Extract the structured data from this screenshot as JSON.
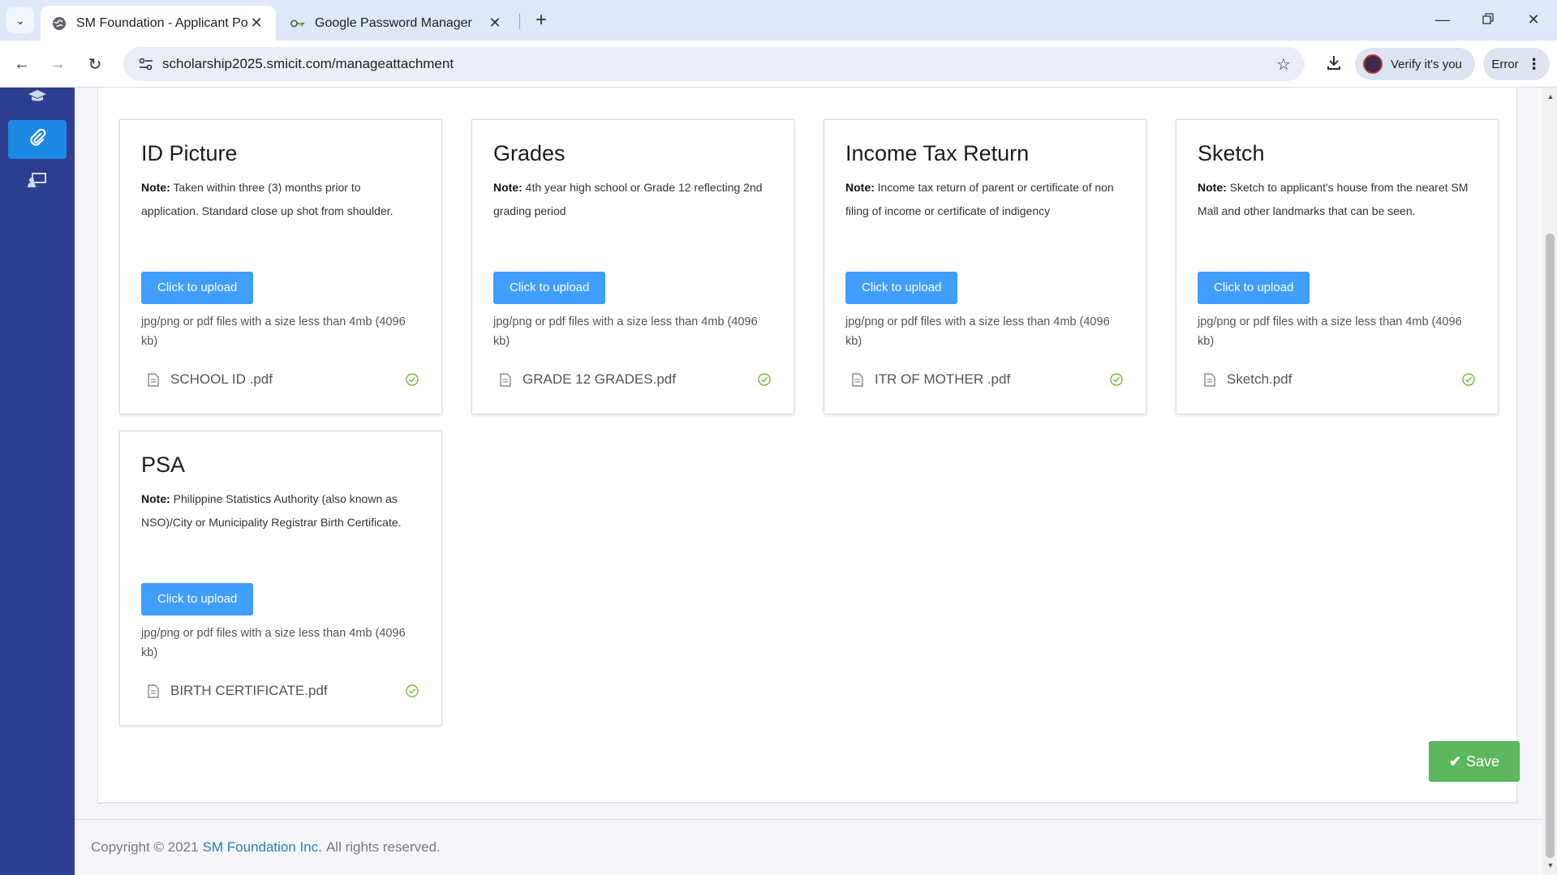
{
  "browser": {
    "tabs": [
      {
        "title": "SM Foundation - Applicant Port",
        "active": true
      },
      {
        "title": "Google Password Manager",
        "active": false
      }
    ],
    "url": "scholarship2025.smicit.com/manageattachment",
    "verify_label": "Verify it's you",
    "error_label": "Error"
  },
  "cards": [
    {
      "title": "ID Picture",
      "note_label": "Note:",
      "note_text": "Taken within three (3) months prior to application. Standard close up shot from shoulder.",
      "button_label": "Click to upload",
      "hint": "jpg/png or pdf files with a size less than 4mb (4096 kb)",
      "file_name": "SCHOOL ID .pdf"
    },
    {
      "title": "Grades",
      "note_label": "Note:",
      "note_text": "4th year high school or Grade 12 reflecting 2nd grading period",
      "button_label": "Click to upload",
      "hint": "jpg/png or pdf files with a size less than 4mb (4096 kb)",
      "file_name": "GRADE 12 GRADES.pdf"
    },
    {
      "title": "Income Tax Return",
      "note_label": "Note:",
      "note_text": "Income tax return of parent or certificate of non filing of income or certificate of indigency",
      "button_label": "Click to upload",
      "hint": "jpg/png or pdf files with a size less than 4mb (4096 kb)",
      "file_name": "ITR OF MOTHER .pdf"
    },
    {
      "title": "Sketch",
      "note_label": "Note:",
      "note_text": "Sketch to applicant's house from the nearet SM Mall and other landmarks that can be seen.",
      "button_label": "Click to upload",
      "hint": "jpg/png or pdf files with a size less than 4mb (4096 kb)",
      "file_name": "Sketch.pdf"
    },
    {
      "title": "PSA",
      "note_label": "Note:",
      "note_text": "Philippine Statistics Authority (also known as NSO)/City or Municipality Registrar Birth Certificate.",
      "button_label": "Click to upload",
      "hint": "jpg/png or pdf files with a size less than 4mb (4096 kb)",
      "file_name": "BIRTH CERTIFICATE.pdf"
    }
  ],
  "save_label": "Save",
  "footer": {
    "prefix": "Copyright © 2021",
    "link": "SM Foundation Inc.",
    "suffix": "All rights reserved."
  },
  "colors": {
    "sidebar": "#2c3e8f",
    "active_item": "#1e88e5",
    "upload_button": "#409eff",
    "save_button": "#5cb85c",
    "success_check": "#67c23a"
  }
}
